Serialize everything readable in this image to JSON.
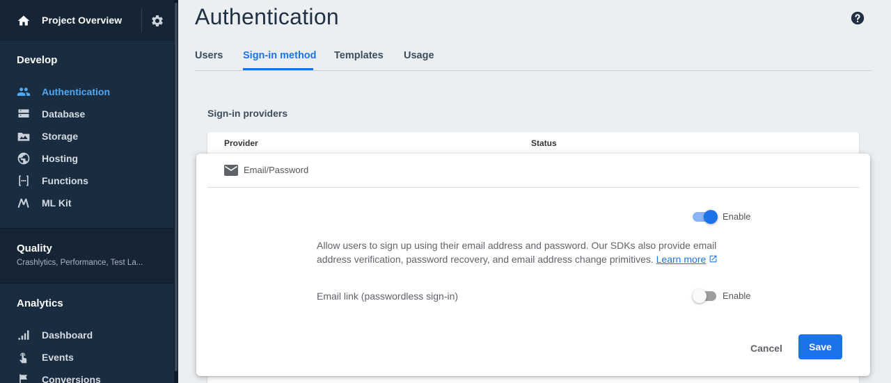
{
  "sidebar": {
    "project_title": "Project Overview",
    "develop": {
      "title": "Develop",
      "items": [
        {
          "label": "Authentication",
          "icon": "people-icon",
          "active": true
        },
        {
          "label": "Database",
          "icon": "database-icon"
        },
        {
          "label": "Storage",
          "icon": "storage-icon"
        },
        {
          "label": "Hosting",
          "icon": "globe-icon"
        },
        {
          "label": "Functions",
          "icon": "functions-icon"
        },
        {
          "label": "ML Kit",
          "icon": "ml-kit-icon"
        }
      ]
    },
    "quality": {
      "title": "Quality",
      "subtitle": "Crashlytics, Performance, Test La..."
    },
    "analytics": {
      "title": "Analytics",
      "items": [
        {
          "label": "Dashboard",
          "icon": "bar-chart-icon"
        },
        {
          "label": "Events",
          "icon": "touch-icon"
        },
        {
          "label": "Conversions",
          "icon": "flag-icon"
        }
      ]
    }
  },
  "main": {
    "title": "Authentication",
    "tabs": [
      {
        "label": "Users"
      },
      {
        "label": "Sign-in method",
        "active": true
      },
      {
        "label": "Templates"
      },
      {
        "label": "Usage"
      }
    ],
    "providers_title": "Sign-in providers",
    "table": {
      "columns": [
        "Provider",
        "Status"
      ]
    },
    "dialog": {
      "provider": "Email/Password",
      "primary_toggle": {
        "label": "Enable",
        "enabled": true
      },
      "description": "Allow users to sign up using their email address and password. Our SDKs also provide email address verification, password recovery, and email address change primitives.",
      "learn_more": "Learn more",
      "email_link_label": "Email link (passwordless sign-in)",
      "secondary_toggle": {
        "label": "Enable",
        "enabled": false
      },
      "cancel_label": "Cancel",
      "save_label": "Save"
    }
  },
  "colors": {
    "sidebar_bg": "#1a2c3f",
    "accent": "#1a73e8",
    "active_nav": "#4fa9f6"
  }
}
